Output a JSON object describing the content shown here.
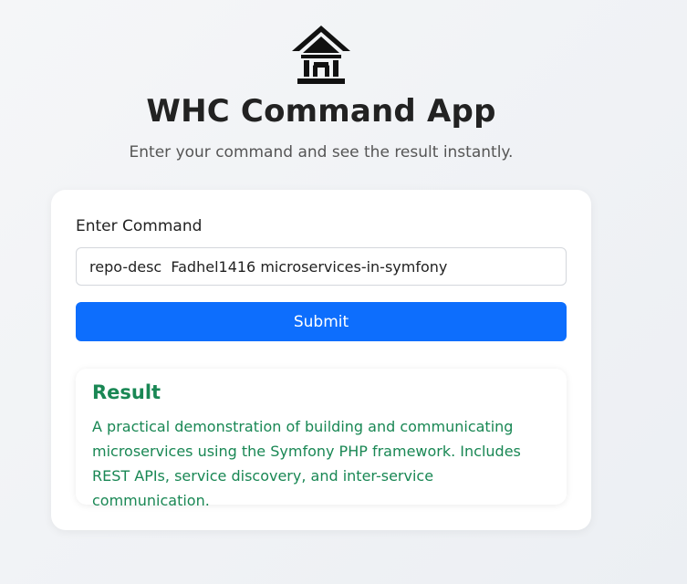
{
  "app": {
    "title": "WHC Command App",
    "subtitle": "Enter your command and see the result instantly.",
    "logo_icon": "bank-building-icon"
  },
  "form": {
    "label": "Enter Command",
    "input_value": "repo-desc  Fadhel1416 microservices-in-symfony",
    "submit_label": "Submit"
  },
  "result": {
    "title": "Result",
    "text": "A practical demonstration of building and communicating microservices using the Symfony PHP framework. Includes REST APIs, service discovery, and inter-service communication."
  },
  "colors": {
    "primary": "#0d6efd",
    "success": "#198754",
    "background": "#f0f2f5"
  }
}
